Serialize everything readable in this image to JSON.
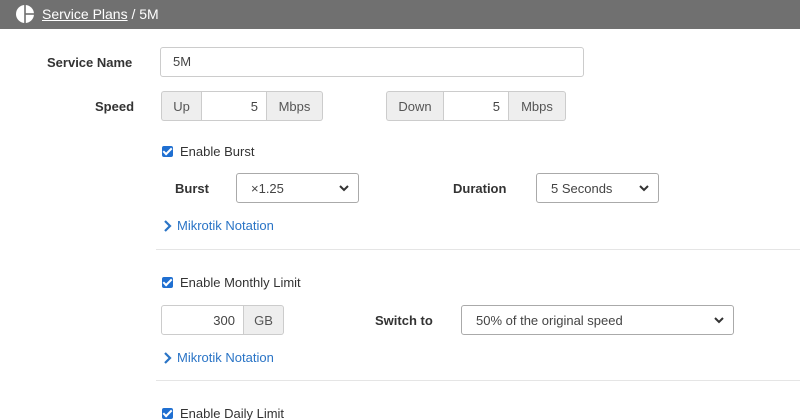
{
  "breadcrumb": {
    "parent": "Service Plans",
    "separator": "/",
    "current": "5M"
  },
  "service_name": {
    "label": "Service Name",
    "value": "5M"
  },
  "speed": {
    "label": "Speed",
    "up": {
      "prefix": "Up",
      "value": "5",
      "unit": "Mbps"
    },
    "down": {
      "prefix": "Down",
      "value": "5",
      "unit": "Mbps"
    }
  },
  "burst": {
    "enable_label": "Enable Burst",
    "enabled": true,
    "burst_label": "Burst",
    "burst_value": "×1.25",
    "duration_label": "Duration",
    "duration_value": "5 Seconds",
    "notation_link": "Mikrotik Notation"
  },
  "monthly": {
    "enable_label": "Enable Monthly Limit",
    "enabled": true,
    "limit_value": "300",
    "limit_unit": "GB",
    "switch_label": "Switch to",
    "switch_value": "50% of the original speed",
    "notation_link": "Mikrotik Notation"
  },
  "daily": {
    "enable_label": "Enable Daily Limit",
    "enabled": true
  },
  "colors": {
    "topbar": "#707070",
    "accent": "#1f6fd1",
    "link": "#2a74c6"
  },
  "icons": {
    "logo": "pie-logo-icon",
    "select": "chevron-down-icon",
    "link": "chevron-right-icon"
  }
}
